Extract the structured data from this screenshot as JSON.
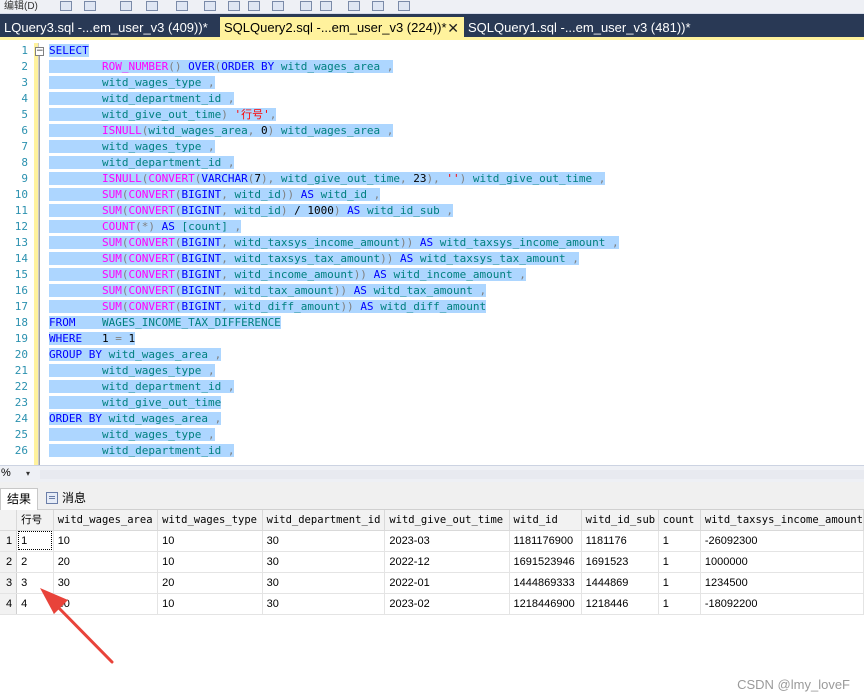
{
  "toolbar": {
    "label": "编辑(D)"
  },
  "tabs": [
    {
      "label": "LQuery3.sql -...em_user_v3 (409))*",
      "active": false
    },
    {
      "label": "SQLQuery2.sql -...em_user_v3 (224))*",
      "active": true
    },
    {
      "label": "SQLQuery1.sql -...em_user_v3 (481))*",
      "active": false
    }
  ],
  "tab_close_glyph": "✕",
  "editor": {
    "line_numbers": [
      "1",
      "2",
      "3",
      "4",
      "5",
      "6",
      "7",
      "8",
      "9",
      "10",
      "11",
      "12",
      "13",
      "14",
      "15",
      "16",
      "17",
      "18",
      "19",
      "20",
      "21",
      "22",
      "23",
      "24",
      "25",
      "26"
    ],
    "outline_glyph": "−"
  },
  "zoom": {
    "value": "%",
    "dropdown": "▾"
  },
  "results_tabs": {
    "results": "结果",
    "messages": "消息"
  },
  "grid": {
    "columns": [
      "行号",
      "witd_wages_area",
      "witd_wages_type",
      "witd_department_id",
      "witd_give_out_time",
      "witd_id",
      "witd_id_sub",
      "count",
      "witd_taxsys_income_amount"
    ],
    "rows": [
      {
        "num": "1",
        "cells": [
          "1",
          "10",
          "10",
          "30",
          "2023-03",
          "1181176900",
          "1181176",
          "1",
          "-26092300"
        ]
      },
      {
        "num": "2",
        "cells": [
          "2",
          "20",
          "10",
          "30",
          "2022-12",
          "1691523946",
          "1691523",
          "1",
          "1000000"
        ]
      },
      {
        "num": "3",
        "cells": [
          "3",
          "30",
          "20",
          "30",
          "2022-01",
          "1444869333",
          "1444869",
          "1",
          "1234500"
        ]
      },
      {
        "num": "4",
        "cells": [
          "4",
          "40",
          "10",
          "30",
          "2023-02",
          "1218446900",
          "1218446",
          "1",
          "-18092200"
        ]
      }
    ]
  },
  "watermark": "CSDN @lmy_loveF",
  "colors": {
    "tab_strip": "#293955",
    "active_tab": "#fff29d",
    "selection": "#add6ff",
    "keyword": "#0000ff",
    "function": "#ff00ff",
    "identifier": "#008080",
    "string": "#ff0000",
    "arrow": "#e8433a"
  }
}
